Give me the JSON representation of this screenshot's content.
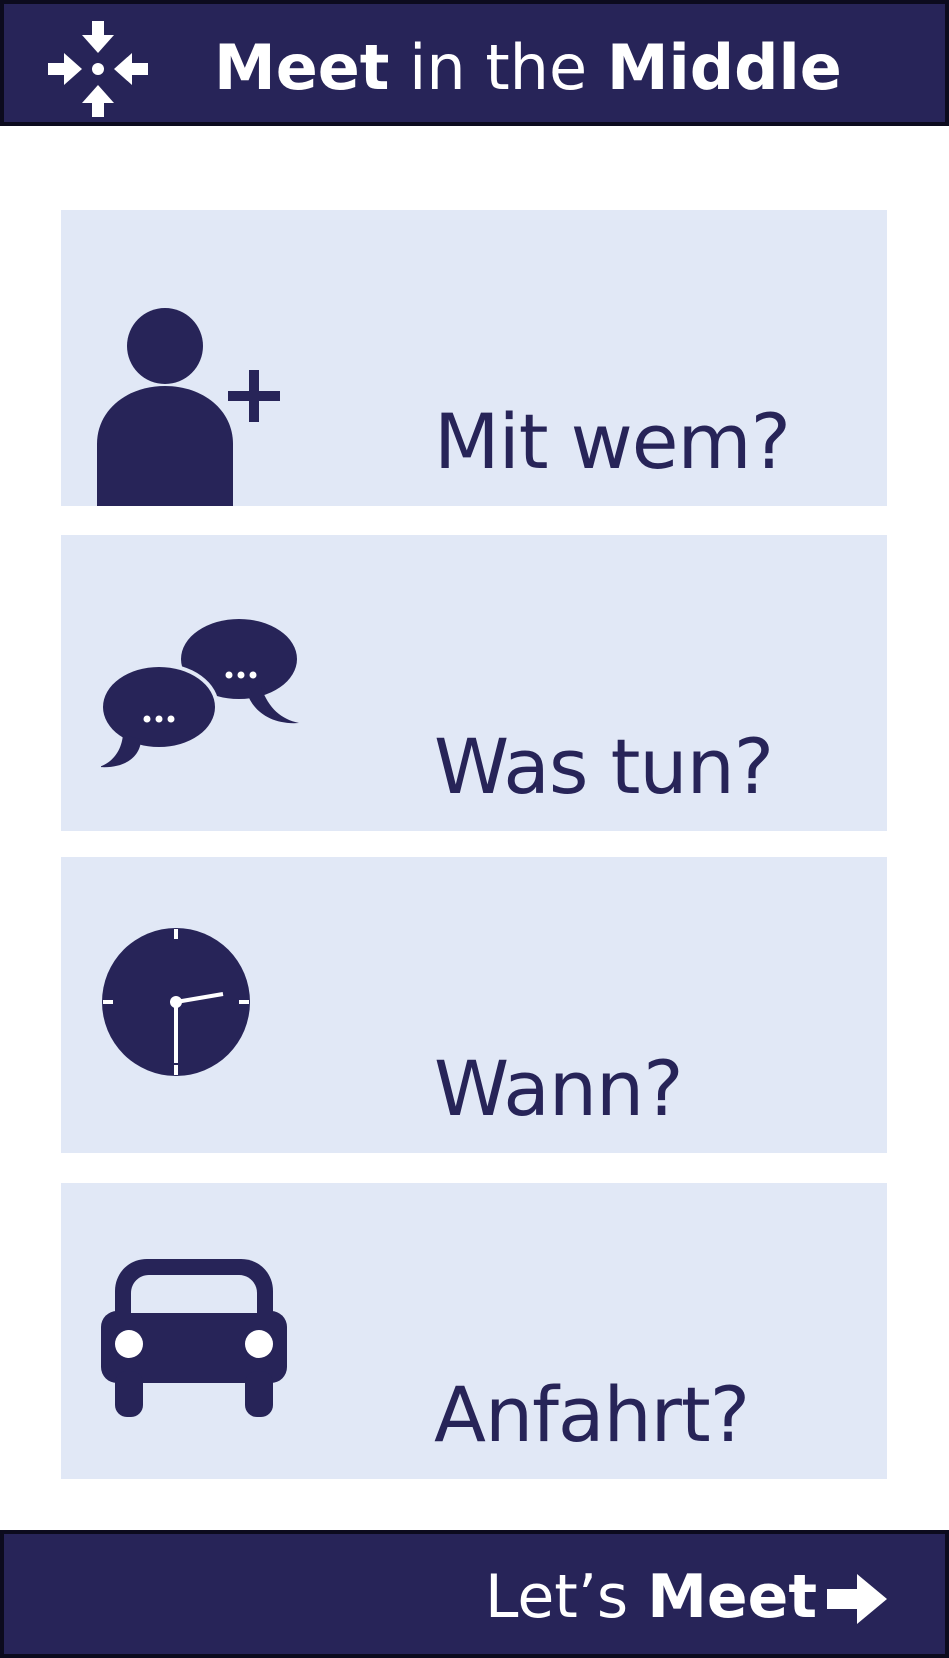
{
  "header": {
    "title_part1": "Meet",
    "title_part2": " in the ",
    "title_part3": "Middle",
    "logo_icon": "converge-arrows-icon"
  },
  "cards": [
    {
      "label": "Mit wem?",
      "icon": "add-person-icon"
    },
    {
      "label": "Was tun?",
      "icon": "chat-bubbles-icon"
    },
    {
      "label": "Wann?",
      "icon": "clock-icon"
    },
    {
      "label": "Anfahrt?",
      "icon": "car-icon"
    }
  ],
  "footer": {
    "cta_part1": "Let’s ",
    "cta_part2": "Meet",
    "arrow_icon": "arrow-right-icon"
  },
  "colors": {
    "primary": "#272458",
    "card_background": "#e1e8f6",
    "text_light": "#ffffff"
  }
}
